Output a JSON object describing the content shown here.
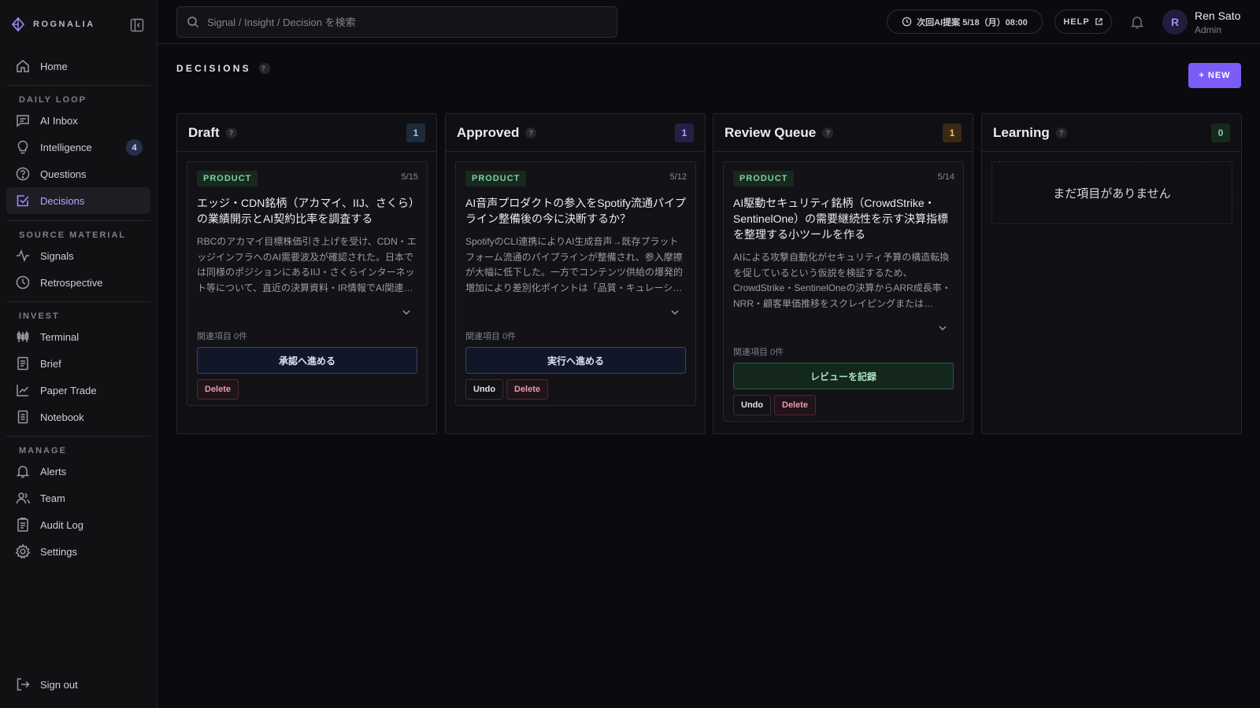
{
  "app": {
    "brand": "ROGNALIA"
  },
  "sidebar": {
    "home": "Home",
    "sections": {
      "daily_loop": "DAILY LOOP",
      "source_material": "SOURCE MATERIAL",
      "invest": "INVEST",
      "manage": "MANAGE"
    },
    "items": {
      "ai_inbox": "AI Inbox",
      "intelligence": "Intelligence",
      "intelligence_badge": "4",
      "questions": "Questions",
      "decisions": "Decisions",
      "signals": "Signals",
      "retrospective": "Retrospective",
      "terminal": "Terminal",
      "brief": "Brief",
      "paper_trade": "Paper Trade",
      "notebook": "Notebook",
      "alerts": "Alerts",
      "team": "Team",
      "audit_log": "Audit Log",
      "settings": "Settings"
    },
    "active": "Decisions",
    "sign_out": "Sign out"
  },
  "topbar": {
    "search_placeholder": "Signal / Insight / Decision を検索",
    "schedule": "次回AI提案 5/18（月）08:00",
    "help": "HELP",
    "user": {
      "initial": "R",
      "name": "Ren Sato",
      "role": "Admin"
    }
  },
  "page": {
    "title": "DECISIONS",
    "help_mark": "?",
    "new_button": "+ NEW"
  },
  "columns": {
    "draft": {
      "title": "Draft",
      "count": "1",
      "card": {
        "tag": "PRODUCT",
        "date": "5/15",
        "title": "エッジ・CDN銘柄（アカマイ、IIJ、さくら）の業績開示とAI契約比率を調査する",
        "desc": "RBCのアカマイ目標株価引き上げを受け、CDN・エッジインフラへのAI需要波及が確認された。日本では同様のポジションにあるIIJ・さくらインターネット等について、直近の決算資料・IR情報でAI関連…",
        "related": "関連項目 0件",
        "primary": "承認へ進める",
        "delete": "Delete"
      }
    },
    "approved": {
      "title": "Approved",
      "count": "1",
      "card": {
        "tag": "PRODUCT",
        "date": "5/12",
        "title": "AI音声プロダクトの参入をSpotify流通パイプライン整備後の今に決断するか？",
        "desc": "SpotifyのCLI連携によりAI生成音声→既存プラットフォーム流通のパイプラインが整備され、参入摩擦が大幅に低下した。一方でコンテンツ供給の爆発的増加により差別化ポイントは「品質・キュレーシ…",
        "related": "関連項目 0件",
        "primary": "実行へ進める",
        "undo": "Undo",
        "delete": "Delete"
      }
    },
    "review_queue": {
      "title": "Review Queue",
      "count": "1",
      "card": {
        "tag": "PRODUCT",
        "date": "5/14",
        "title": "AI駆動セキュリティ銘柄（CrowdStrike・SentinelOne）の需要継続性を示す決算指標を整理する小ツールを作る",
        "desc": "AIによる攻撃自動化がセキュリティ予算の構造転換を促しているという仮説を検証するため、CrowdStrike・SentinelOneの決算からARR成長率・NRR・顧客単価推移をスクレイピングまたは…",
        "related": "関連項目 0件",
        "primary": "レビューを記録",
        "undo": "Undo",
        "delete": "Delete"
      }
    },
    "learning": {
      "title": "Learning",
      "count": "0",
      "empty": "まだ項目がありません"
    }
  },
  "colors": {
    "accent": "#7c5cf6",
    "background": "#0b0b0f",
    "tag_green": "#7fd0a0",
    "delete_red": "#e79aa6"
  }
}
